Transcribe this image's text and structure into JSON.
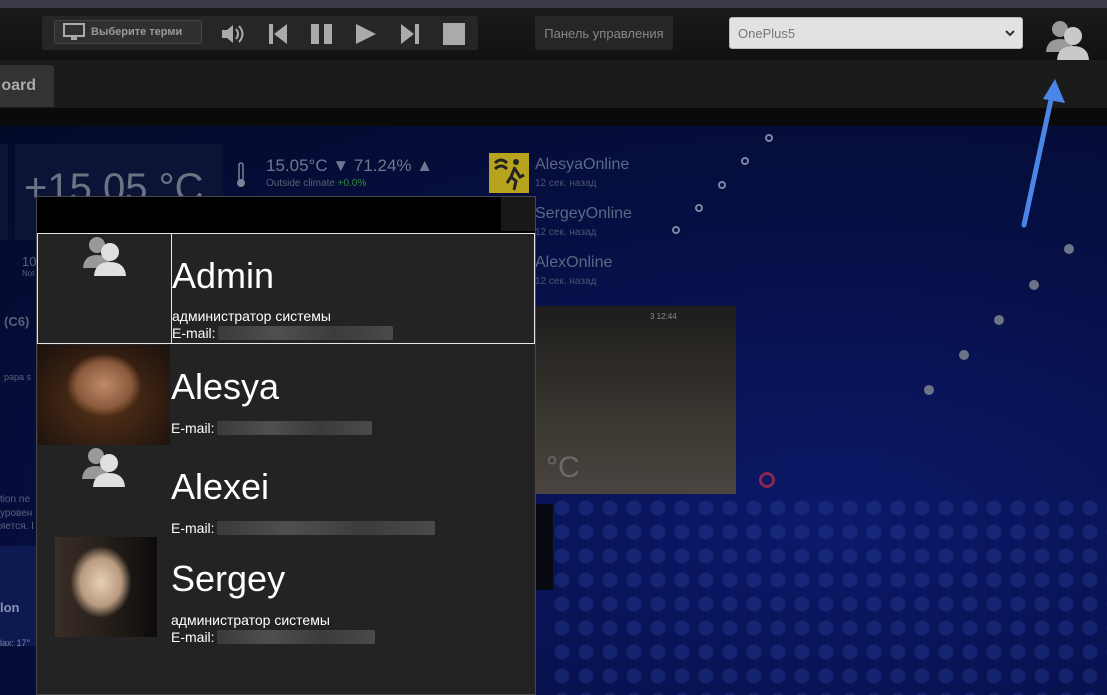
{
  "topbar": {
    "terminal_button_label": "Выберите терми",
    "control_panel_label": "Панель управления",
    "device_select": {
      "selected": "OnePlus5"
    }
  },
  "tabs": {
    "active_label": "oard"
  },
  "dashboard": {
    "big_temperature": "+15.05 °C",
    "climate": {
      "values": "15.05°C ▼ 71.24% ▲",
      "label": "Outside climate",
      "change": "+0.0%"
    },
    "online": [
      {
        "name": "AlesyaOnline",
        "time": "12 сек. назад"
      },
      {
        "name": "SergeyOnline",
        "time": "12 сек. назад"
      },
      {
        "name": "AlexOnline",
        "time": "12 сек. назад"
      }
    ],
    "camera": {
      "temperature": "°C",
      "timestamp": "3 12:44"
    },
    "side_texts": [
      "(C6)",
      "papa s",
      "tion ne",
      "уровен",
      "яется. I",
      "lon",
      "lax: 17°",
      "10",
      "Not"
    ]
  },
  "users": [
    {
      "name": "Admin",
      "role": "администратор системы",
      "email_label": "E-mail:",
      "avatar": "default-user-icon",
      "selected": true
    },
    {
      "name": "Alesya",
      "role": "",
      "email_label": "E-mail:",
      "avatar": "photo"
    },
    {
      "name": "Alexei",
      "role": "",
      "email_label": "E-mail:",
      "avatar": "default-user-icon"
    },
    {
      "name": "Sergey",
      "role": "администратор системы",
      "email_label": "E-mail:",
      "avatar": "photo"
    }
  ],
  "colors": {
    "accent_arrow": "#4a86e8",
    "dropdown_bg": "#232323",
    "selected_border": "#e8e8e8"
  }
}
